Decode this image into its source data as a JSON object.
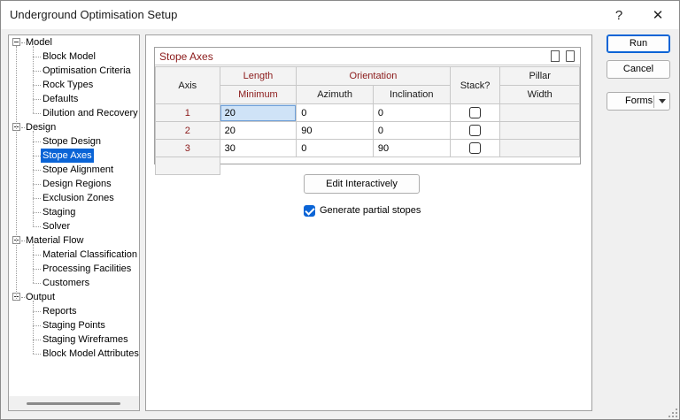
{
  "window": {
    "title": "Underground Optimisation Setup",
    "help_glyph": "?",
    "close_glyph": "✕"
  },
  "tree": {
    "groups": [
      {
        "label": "Model",
        "items": [
          "Block Model",
          "Optimisation Criteria",
          "Rock Types",
          "Defaults",
          "Dilution and Recovery"
        ]
      },
      {
        "label": "Design",
        "items": [
          "Stope Design",
          "Stope Axes",
          "Stope Alignment",
          "Design Regions",
          "Exclusion Zones",
          "Staging",
          "Solver"
        ]
      },
      {
        "label": "Material Flow",
        "items": [
          "Material Classification",
          "Processing Facilities",
          "Customers"
        ]
      },
      {
        "label": "Output",
        "items": [
          "Reports",
          "Staging Points",
          "Staging Wireframes",
          "Block Model Attributes"
        ]
      }
    ],
    "selected": "Stope Axes"
  },
  "grid": {
    "title": "Stope Axes",
    "headers": {
      "axis": "Axis",
      "length": "Length",
      "minimum": "Minimum",
      "orientation": "Orientation",
      "azimuth": "Azimuth",
      "inclination": "Inclination",
      "stack": "Stack?",
      "pillar": "Pillar",
      "width": "Width"
    },
    "rows": [
      {
        "axis": "1",
        "minimum": "20",
        "azimuth": "0",
        "inclination": "0",
        "stack": false,
        "width": ""
      },
      {
        "axis": "2",
        "minimum": "20",
        "azimuth": "90",
        "inclination": "0",
        "stack": false,
        "width": ""
      },
      {
        "axis": "3",
        "minimum": "30",
        "azimuth": "0",
        "inclination": "90",
        "stack": false,
        "width": ""
      }
    ]
  },
  "actions": {
    "edit_interactively": "Edit Interactively",
    "generate_partial_stopes": "Generate partial stopes",
    "generate_partial_stopes_checked": true
  },
  "buttons": {
    "run": "Run",
    "cancel": "Cancel",
    "forms": "Forms"
  },
  "colors": {
    "accent": "#0a64d6",
    "header_text": "#8b1a1a"
  }
}
